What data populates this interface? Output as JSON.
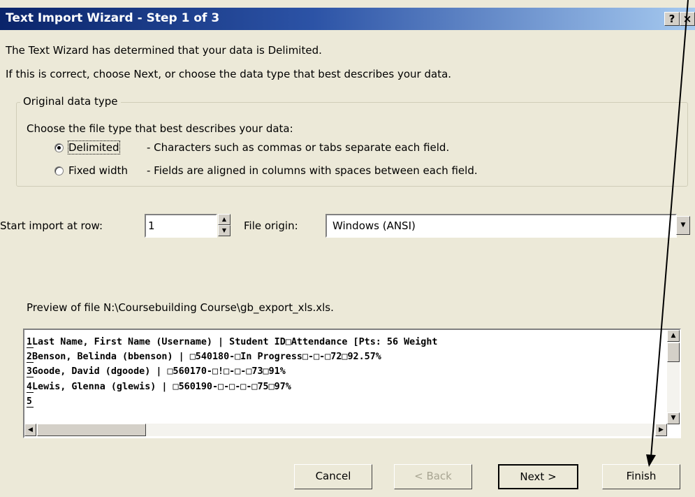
{
  "window": {
    "title": "Text Import Wizard - Step 1 of 3",
    "help_button": "?",
    "close_button": "×"
  },
  "intro": {
    "line1": "The Text Wizard has determined that your data is Delimited.",
    "line2": "If this is correct, choose Next, or choose the data type that best describes your data."
  },
  "data_type": {
    "group_label": "Original data type",
    "prompt": "Choose the file type that best describes your data:",
    "options": [
      {
        "label": "Delimited",
        "description": "- Characters such as commas or tabs separate each field.",
        "selected": true
      },
      {
        "label": "Fixed width",
        "description": "- Fields are aligned in columns with spaces between each field.",
        "selected": false
      }
    ]
  },
  "import_settings": {
    "start_row_label": "Start import at row:",
    "start_row_value": "1",
    "file_origin_label": "File origin:",
    "file_origin_value": "Windows (ANSI)"
  },
  "preview": {
    "label": "Preview of file N:\\Coursebuilding Course\\gb_export_xls.xls.",
    "line_numbers": [
      "1",
      "2",
      "3",
      "4",
      "5"
    ],
    "lines": [
      "Last Name, First Name (Username) | Student ID□Attendance [Pts: 56 Weight",
      "Benson, Belinda (bbenson) | □540180-□In Progress□-□-□72□92.57%",
      "Goode, David (dgoode) | □560170-□!□-□-□73□91%",
      "Lewis, Glenna (glewis) | □560190-□-□-□-□75□97%",
      ""
    ]
  },
  "buttons": {
    "cancel": "Cancel",
    "back": "< Back",
    "next": "Next >",
    "finish": "Finish"
  },
  "colors": {
    "dialog_bg": "#ECE9D8",
    "title_start": "#0A246A",
    "title_end": "#A6CAF0"
  }
}
